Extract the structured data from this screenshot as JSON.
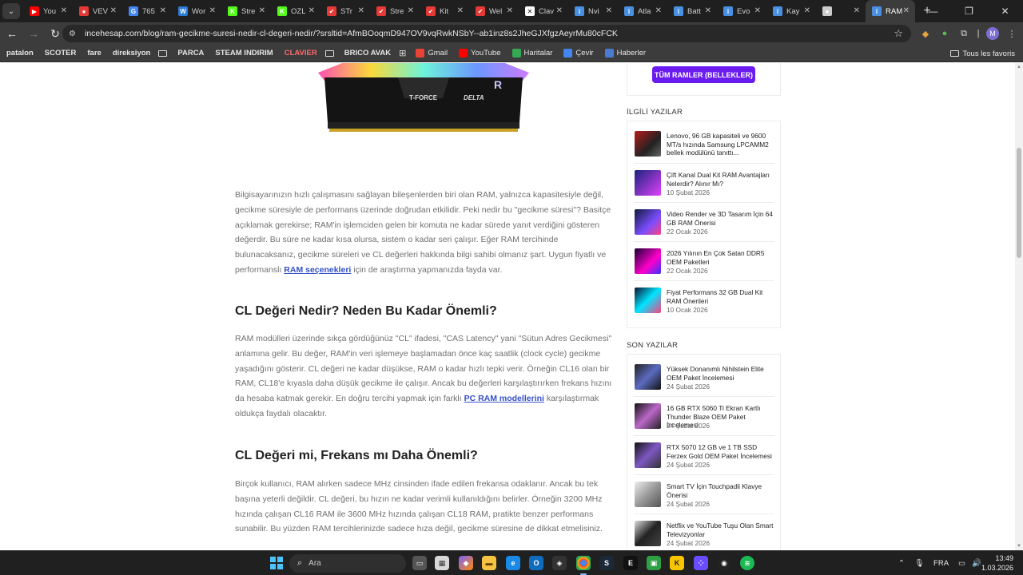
{
  "browser": {
    "tabs": [
      {
        "title": "You",
        "color": "#ff0000",
        "glyph": "▶"
      },
      {
        "title": "VEV",
        "color": "#e53935",
        "glyph": "●"
      },
      {
        "title": "765",
        "color": "#4285f4",
        "glyph": "G"
      },
      {
        "title": "Wor",
        "color": "#2b7cd3",
        "glyph": "W"
      },
      {
        "title": "Stre",
        "color": "#53fc18",
        "glyph": "K"
      },
      {
        "title": "OZL",
        "color": "#53fc18",
        "glyph": "K"
      },
      {
        "title": "STr",
        "color": "#e53935",
        "glyph": "✔"
      },
      {
        "title": "Stre",
        "color": "#e53935",
        "glyph": "✔"
      },
      {
        "title": "Kit",
        "color": "#e53935",
        "glyph": "✔"
      },
      {
        "title": "Wel",
        "color": "#e53935",
        "glyph": "✔"
      },
      {
        "title": "Clav",
        "color": "#ffffff",
        "glyph": "✕"
      },
      {
        "title": "Nvi",
        "color": "#4a90e2",
        "glyph": "i"
      },
      {
        "title": "Atla",
        "color": "#4a90e2",
        "glyph": "i"
      },
      {
        "title": "Batt",
        "color": "#4a90e2",
        "glyph": "i"
      },
      {
        "title": "Evo",
        "color": "#4a90e2",
        "glyph": "i"
      },
      {
        "title": "Kay",
        "color": "#4a90e2",
        "glyph": "i"
      },
      {
        "title": "",
        "color": "#cccccc",
        "glyph": "●"
      },
      {
        "title": "RAM",
        "color": "#4a90e2",
        "glyph": "i",
        "active": true
      }
    ],
    "url": "incehesap.com/blog/ram-gecikme-suresi-nedir-cl-degeri-nedir/?srsltid=AfmBOoqmD947OV9vqRwkNSbY--ab1inz8s2JheGJXfgzAeyrMu80cFCK",
    "profile_initial": "M"
  },
  "bookmarks": [
    {
      "label": "patalon",
      "style": "bold"
    },
    {
      "label": "SCOTER",
      "style": "bold"
    },
    {
      "label": "fare",
      "style": "bold"
    },
    {
      "label": "direksiyon",
      "style": "bold"
    },
    {
      "label": "PARCA",
      "style": "bold"
    },
    {
      "label": "STEAM INDIRIM",
      "style": "bold"
    },
    {
      "label": "CLAVIER",
      "style": "red"
    },
    {
      "label": "BRICO AVAK",
      "style": "bold"
    },
    {
      "label": "Gmail",
      "style": "normal"
    },
    {
      "label": "YouTube",
      "style": "normal"
    },
    {
      "label": "Haritalar",
      "style": "normal"
    },
    {
      "label": "Çevir",
      "style": "normal"
    },
    {
      "label": "Haberler",
      "style": "normal"
    }
  ],
  "bookmarks_right": "Tous les favoris",
  "product_image_labels": {
    "brand": "T-FORCE",
    "model": "DELTA"
  },
  "article": {
    "intro": {
      "before_link": "Bilgisayarınızın hızlı çalışmasını sağlayan bileşenlerden biri olan RAM, yalnızca kapasitesiyle değil, gecikme süresiyle de performans üzerinde doğrudan etkilidir. Peki nedir bu \"gecikme süresi\"? Basitçe açıklamak gerekirse; RAM'in işlemciden gelen bir komuta ne kadar sürede yanıt verdiğini gösteren değerdir. Bu süre ne kadar kısa olursa, sistem o kadar seri çalışır. Eğer RAM tercihinde bulunacaksanız, gecikme süreleri ve CL değerleri hakkında bilgi sahibi olmanız şart. Uygun fiyatlı ve performanslı ",
      "link": "RAM seçenekleri",
      "after_link": " için de araştırma yapmanızda fayda var."
    },
    "section1": {
      "heading": "CL Değeri Nedir? Neden Bu Kadar Önemli?",
      "before_link": "RAM modülleri üzerinde sıkça gördüğünüz \"CL\" ifadesi, \"CAS Latency\" yani \"Sütun Adres Gecikmesi\" anlamına gelir. Bu değer, RAM'in veri işlemeye başlamadan önce kaç saatlik (clock cycle) gecikme yaşadığını gösterir. CL değeri ne kadar düşükse, RAM o kadar hızlı tepki verir. Örneğin CL16 olan bir RAM, CL18'e kıyasla daha düşük gecikme ile çalışır. Ancak bu değerleri karşılaştırırken frekans hızını da hesaba katmak gerekir. En doğru tercihi yapmak için farklı ",
      "link": "PC RAM modellerini",
      "after_link": " karşılaştırmak oldukça faydalı olacaktır."
    },
    "section2": {
      "heading": "CL Değeri mi, Frekans mı Daha Önemli?",
      "text": "Birçok kullanıcı, RAM alırken sadece MHz cinsinden ifade edilen frekansa odaklanır. Ancak bu tek başına yeterli değildir. CL değeri, bu hızın ne kadar verimli kullanıldığını belirler. Örneğin 3200 MHz hızında çalışan CL16 RAM ile 3600 MHz hızında çalışan CL18 RAM, pratikte benzer performans sunabilir. Bu yüzden RAM tercihlerinizde sadece hıza değil, gecikme süresine de dikkat etmelisiniz."
    }
  },
  "sidebar": {
    "button_label": "TÜM RAMLER (BELLEKLER)",
    "related_heading": "İLGİLİ YAZILAR",
    "related": [
      {
        "title": "Lenovo, 96 GB kapasiteli ve 9600 MT/s hızında Samsung LPCAMM2 bellek modülünü tanıttı...",
        "date": ""
      },
      {
        "title": "Çift Kanal Dual Kit RAM Avantajları Nelerdir? Alınır Mı?",
        "date": "10 Şubat 2026"
      },
      {
        "title": "Video Render ve 3D Tasarım İçin 64 GB RAM Önerisi",
        "date": "22 Ocak 2026"
      },
      {
        "title": "2026 Yılının En Çok Satan DDR5 OEM Paketleri",
        "date": "22 Ocak 2026"
      },
      {
        "title": "Fiyat Performans 32 GB Dual Kit RAM Önerileri",
        "date": "10 Ocak 2026"
      }
    ],
    "recent_heading": "SON YAZILAR",
    "recent": [
      {
        "title": "Yüksek Donanımlı Nihilstein Elite OEM Paket İncelemesi",
        "date": "24 Şubat 2026"
      },
      {
        "title": "16 GB RTX 5060 Ti Ekran Kartlı Thunder Blaze OEM Paket İncelemesi",
        "date": "24 Şubat 2026"
      },
      {
        "title": "RTX 5070 12 GB ve 1 TB SSD Ferzex Gold OEM Paket İncelemesi",
        "date": "24 Şubat 2026"
      },
      {
        "title": "Smart TV İçin Touchpadli Klavye Önerisi",
        "date": "24 Şubat 2026"
      },
      {
        "title": "Netflix ve YouTube Tuşu Olan Smart Televizyonlar",
        "date": "24 Şubat 2026"
      }
    ]
  },
  "taskbar": {
    "search_placeholder": "Ara",
    "language": "FRA",
    "time": "13:49",
    "date": "1.03.2026"
  }
}
